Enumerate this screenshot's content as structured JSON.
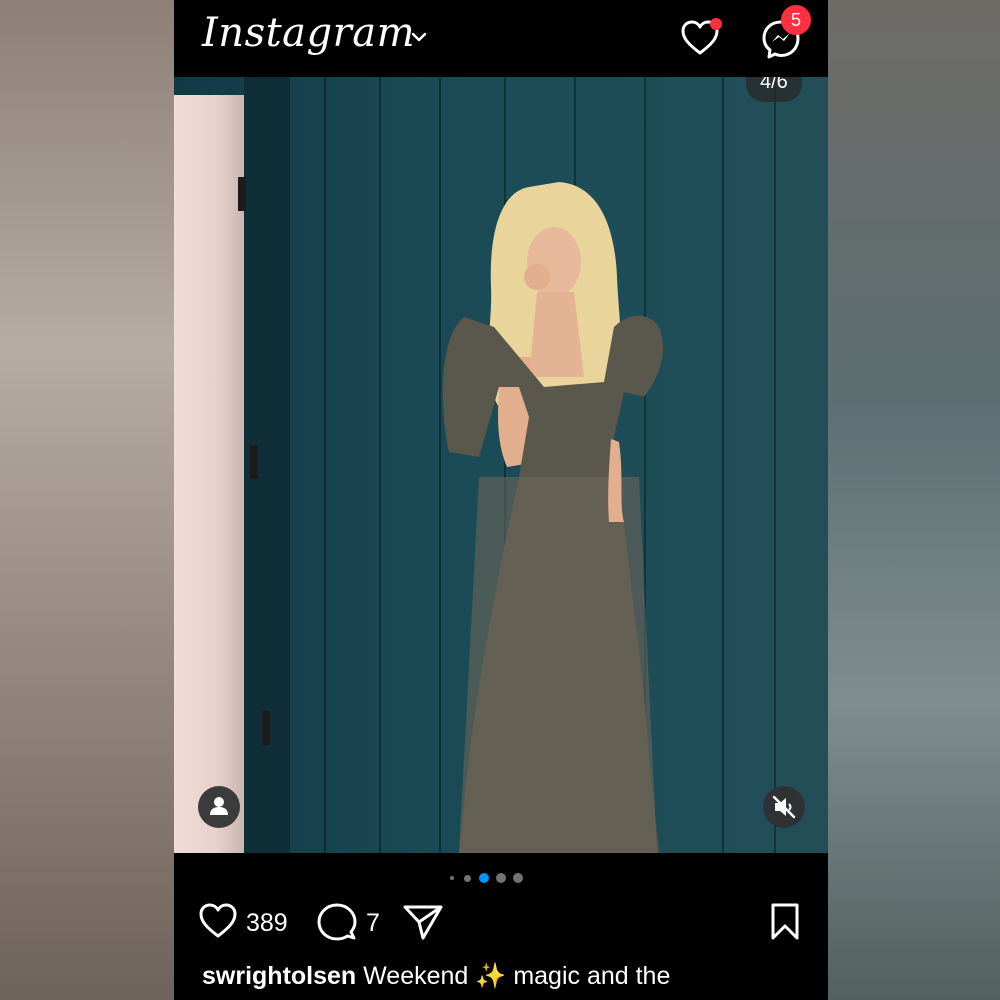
{
  "header": {
    "app_name": "Instagram",
    "notifications_icon": "heart-icon",
    "messages_icon": "messenger-icon",
    "messages_badge": "5"
  },
  "post": {
    "carousel_position": "4/6",
    "carousel_dots": 5,
    "carousel_active_index": 2,
    "likes": "389",
    "comments": "7",
    "username": "swrightolsen",
    "caption_text": "Weekend ✨ magic and the",
    "tag_users_icon": "person-icon",
    "mute_icon": "speaker-muted-icon"
  },
  "colors": {
    "background": "#000000",
    "badge": "#ff3040",
    "active_dot": "#0095f6",
    "inactive_dot": "#737373",
    "text": "#ffffff"
  }
}
